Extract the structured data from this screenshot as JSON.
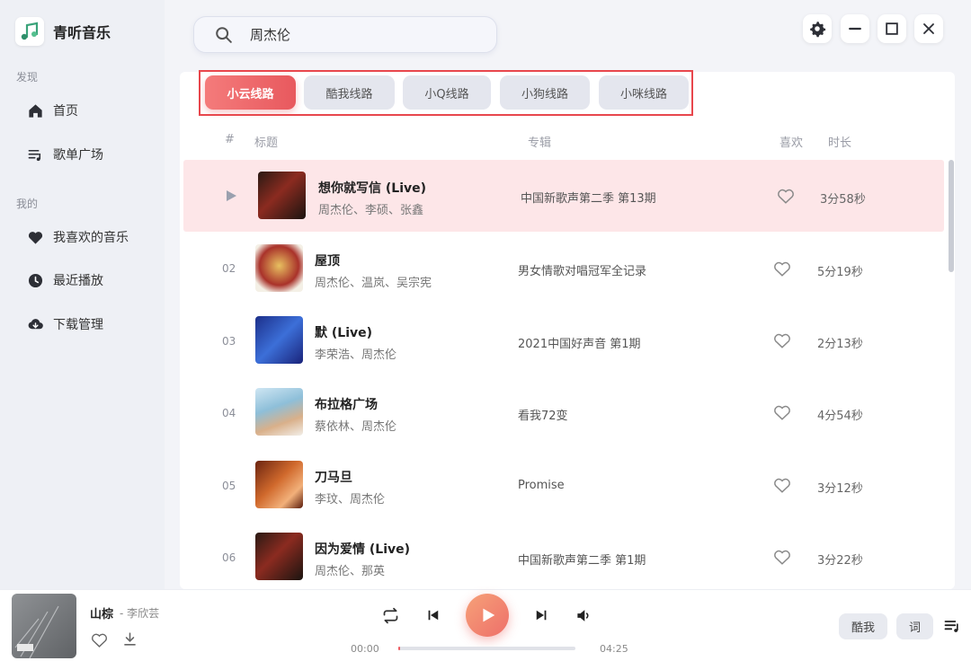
{
  "app": {
    "name": "青听音乐"
  },
  "sidebar": {
    "sections": {
      "discover": "发现",
      "mine": "我的"
    },
    "items": [
      {
        "label": "首页",
        "icon": "home-icon"
      },
      {
        "label": "歌单广场",
        "icon": "playlist-icon"
      },
      {
        "label": "我喜欢的音乐",
        "icon": "heart-icon"
      },
      {
        "label": "最近播放",
        "icon": "clock-icon"
      },
      {
        "label": "下载管理",
        "icon": "cloud-download-icon"
      }
    ]
  },
  "search": {
    "value": "周杰伦",
    "placeholder": ""
  },
  "routes": [
    {
      "label": "小云线路",
      "active": true
    },
    {
      "label": "酷我线路",
      "active": false
    },
    {
      "label": "小Q线路",
      "active": false
    },
    {
      "label": "小狗线路",
      "active": false
    },
    {
      "label": "小咪线路",
      "active": false
    }
  ],
  "columns": {
    "num": "#",
    "title": "标题",
    "album": "专辑",
    "like": "喜欢",
    "duration": "时长"
  },
  "songs": [
    {
      "num": "",
      "title": "想你就写信 (Live)",
      "artists": "周杰伦、李硕、张鑫",
      "album": "中国新歌声第二季 第13期",
      "duration": "3分58秒",
      "playing": true
    },
    {
      "num": "02",
      "title": "屋顶",
      "artists": "周杰伦、温岚、吴宗宪",
      "album": "男女情歌对唱冠军全记录",
      "duration": "5分19秒"
    },
    {
      "num": "03",
      "title": "默 (Live)",
      "artists": "李荣浩、周杰伦",
      "album": "2021中国好声音 第1期",
      "duration": "2分13秒"
    },
    {
      "num": "04",
      "title": "布拉格广场",
      "artists": "蔡依林、周杰伦",
      "album": "看我72变",
      "duration": "4分54秒"
    },
    {
      "num": "05",
      "title": "刀马旦",
      "artists": "李玟、周杰伦",
      "album": "Promise",
      "duration": "3分12秒"
    },
    {
      "num": "06",
      "title": "因为爱情 (Live)",
      "artists": "周杰伦、那英",
      "album": "中国新歌声第二季 第1期",
      "duration": "3分22秒"
    }
  ],
  "player": {
    "title": "山棕",
    "artist": "- 李欣芸",
    "current_time": "00:00",
    "total_time": "04:25",
    "progress": 0.01,
    "source_button": "酷我",
    "lyrics_button": "词"
  },
  "colors": {
    "accent": "#e8595e",
    "highlight_row": "#fde6e8"
  }
}
